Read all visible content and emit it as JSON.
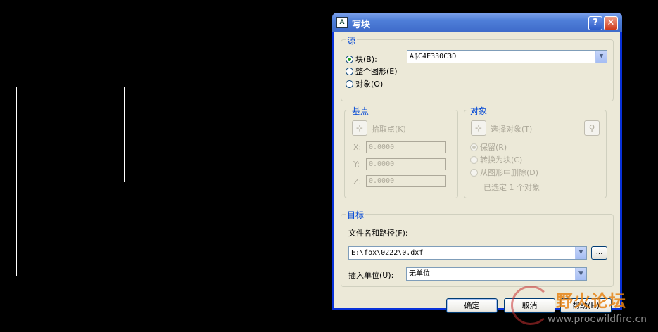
{
  "dialog": {
    "title": "写块",
    "help_label": "?",
    "close_label": "✕",
    "icon_label": "A",
    "source": {
      "label": "源",
      "block_label": "块(B):",
      "block_value": "A$C4E330C3D",
      "entire_drawing_label": "整个图形(E)",
      "objects_label": "对象(O)",
      "selected": "block"
    },
    "base_point": {
      "label": "基点",
      "pick_label": "拾取点(K)",
      "x_label": "X:",
      "x_value": "0.0000",
      "y_label": "Y:",
      "y_value": "0.0000",
      "z_label": "Z:",
      "z_value": "0.0000"
    },
    "objects": {
      "label": "对象",
      "select_label": "选择对象(T)",
      "retain_label": "保留(R)",
      "convert_label": "转换为块(C)",
      "delete_label": "从图形中删除(D)",
      "status": "已选定 1 个对象"
    },
    "destination": {
      "label": "目标",
      "file_label": "文件名和路径(F):",
      "file_value": "E:\\fox\\0222\\0.dxf",
      "browse_label": "...",
      "units_label": "插入单位(U):",
      "units_value": "无单位"
    },
    "buttons": {
      "ok": "确定",
      "cancel": "取消",
      "help": "帮助(H)"
    }
  },
  "watermark": {
    "text": "野火论坛",
    "url": "www.proewildfire.cn"
  },
  "colors": {
    "title_bar": "#3e6ac9",
    "group_label": "#0046d5",
    "dialog_face": "#ece9d8"
  }
}
